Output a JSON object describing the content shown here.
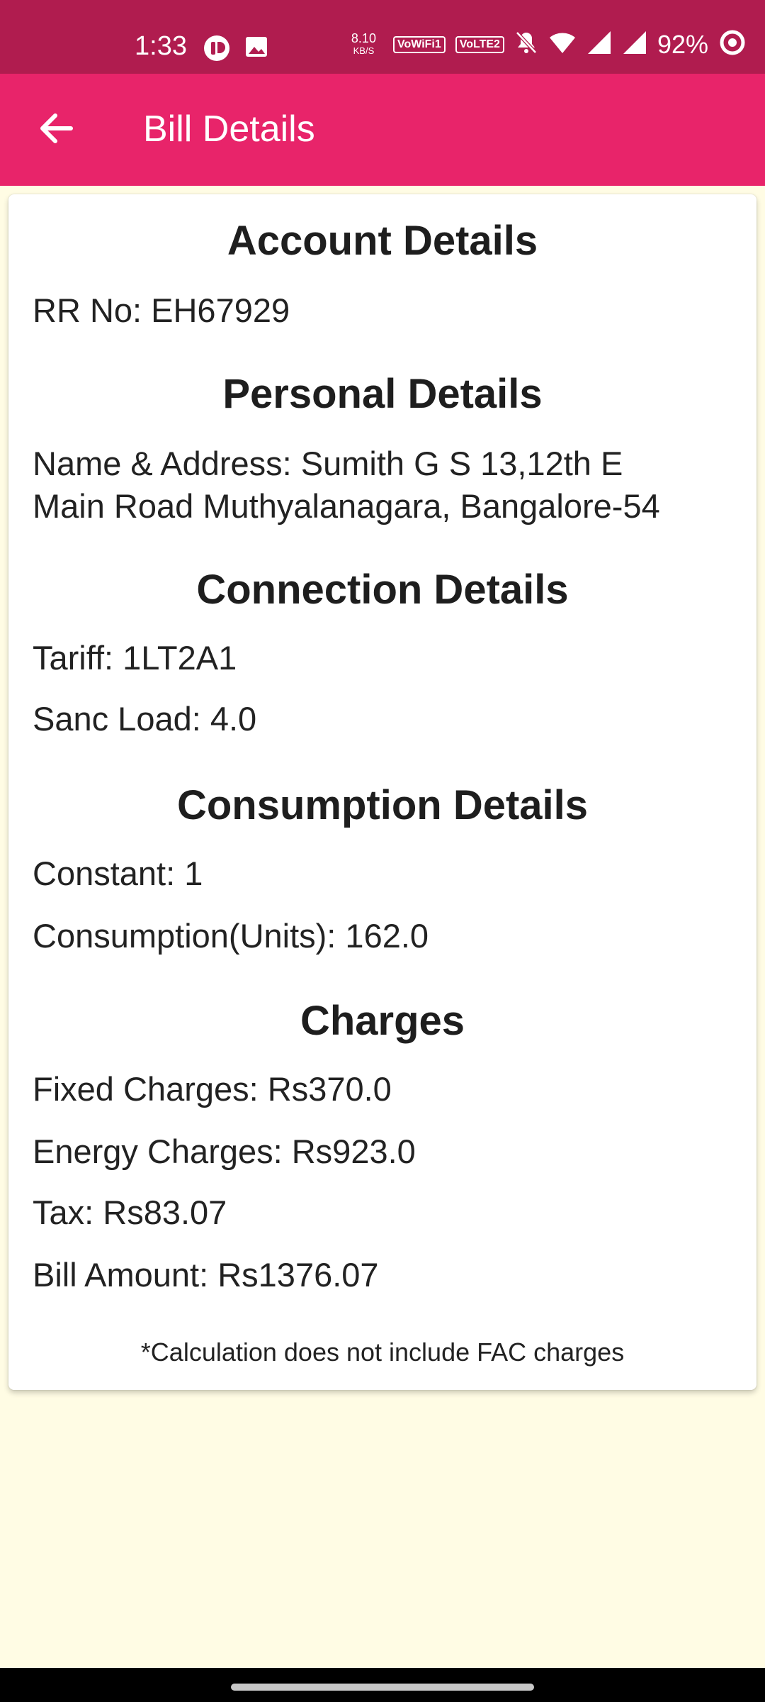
{
  "status_bar": {
    "time": "1:33",
    "net_speed_value": "8.10",
    "net_speed_unit": "KB/S",
    "vowifi_badge": "VoWiFi1",
    "volte_badge": "VoLTE2",
    "battery": "92%",
    "icons": [
      "app-notification-icon",
      "image-notification-icon",
      "mute-icon",
      "wifi-icon",
      "signal-icon",
      "signal-icon",
      "battery-ring-icon"
    ]
  },
  "app_bar": {
    "title": "Bill Details",
    "back_icon": "arrow-back-icon"
  },
  "account": {
    "title": "Account Details",
    "rr_no": "RR No: EH67929"
  },
  "personal": {
    "title": "Personal Details",
    "name_address_line1": "Name & Address: Sumith G S 13,12th E",
    "name_address_line2": "Main Road Muthyalanagara, Bangalore-54"
  },
  "connection": {
    "title": "Connection Details",
    "tariff": "Tariff: 1LT2A1",
    "sanc_load": "Sanc Load: 4.0"
  },
  "consumption": {
    "title": "Consumption Details",
    "constant": "Constant: 1",
    "units": "Consumption(Units): 162.0"
  },
  "charges": {
    "title": "Charges",
    "fixed": "Fixed Charges: Rs370.0",
    "energy": "Energy Charges: Rs923.0",
    "tax": "Tax: Rs83.07",
    "bill_amount": "Bill Amount: Rs1376.07",
    "note": "*Calculation does not include FAC charges"
  },
  "colors": {
    "status_bar": "#b01c4f",
    "app_bar": "#e8246a",
    "background": "#fffce4"
  }
}
